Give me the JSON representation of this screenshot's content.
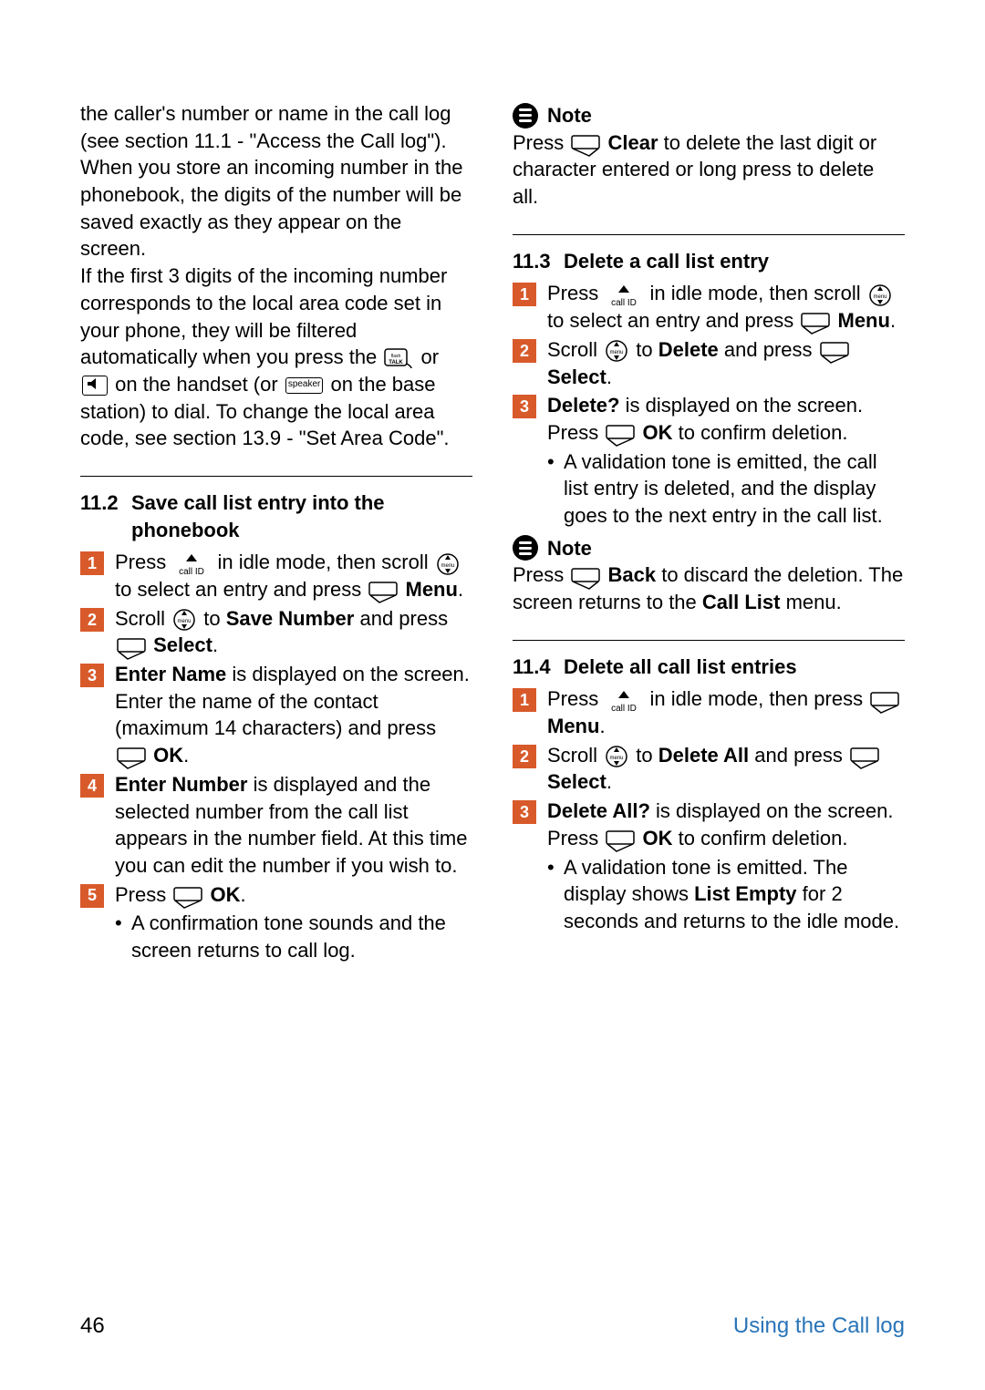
{
  "page_number": "46",
  "footer_title": "Using the Call log",
  "left": {
    "p1a": "the caller's number or name in the call log (see section 11.1 - \"Access the Call log\").",
    "p1b": "When you store an incoming number in the phonebook, the digits of the number will be saved exactly as they appear on the screen.",
    "p1c_a": "If the first 3 digits of the incoming number corresponds to the local area code set in your phone, they will be filtered automatically when you press the ",
    "p1c_b": " or ",
    "p1c_c": " on the handset (or ",
    "p1c_d": " on the base station) to dial. To change the local area code, see section 13.9 - \"Set Area Code\".",
    "sec112_num": "11.2",
    "sec112_title": "Save call list entry into the phonebook",
    "s112": {
      "n1": "1",
      "n2": "2",
      "n3": "3",
      "n4": "4",
      "n5": "5",
      "t1a": "Press ",
      "t1b": " in idle mode, then scroll ",
      "t1c": " to select an entry and press ",
      "t1d": "Menu",
      "t1e": ".",
      "t2a": "Scroll ",
      "t2b": " to ",
      "t2c": "Save Number",
      "t2d": " and press ",
      "t2e": "Select",
      "t2f": ".",
      "t3a": "Enter Name",
      "t3b": " is displayed on the screen. Enter the name of the contact (maximum 14 characters) and press ",
      "t3c": "OK",
      "t3d": ".",
      "t4a": "Enter Number",
      "t4b": " is displayed and the selected number from the call list appears in the number field. At this time you can edit the number if you wish to.",
      "t5a": "Press ",
      "t5b": "OK",
      "t5c": ".",
      "b1": "A confirmation tone sounds and the screen returns to call log."
    }
  },
  "right": {
    "note1_label": "Note",
    "note1a": "Press ",
    "note1b": "Clear",
    "note1c": " to delete the last digit or character entered or long press to delete all.",
    "sec113_num": "11.3",
    "sec113_title": "Delete a call list entry",
    "s113": {
      "n1": "1",
      "n2": "2",
      "n3": "3",
      "t1a": "Press ",
      "t1b": " in idle mode, then scroll ",
      "t1c": " to select an entry and press ",
      "t1d": "Menu",
      "t1e": ".",
      "t2a": "Scroll ",
      "t2b": " to ",
      "t2c": "Delete",
      "t2d": " and press ",
      "t2e": "Select",
      "t2f": ".",
      "t3a": "Delete?",
      "t3b": " is displayed on the screen. Press ",
      "t3c": "OK",
      "t3d": " to confirm deletion.",
      "b1": "A validation tone is emitted, the call list entry is deleted, and the display goes to the next entry in the call list."
    },
    "note2_label": "Note",
    "note2a": "Press ",
    "note2b": "Back",
    "note2c": " to discard the deletion. The screen returns to the ",
    "note2d": "Call List",
    "note2e": " menu.",
    "sec114_num": "11.4",
    "sec114_title": "Delete all call list entries",
    "s114": {
      "n1": "1",
      "n2": "2",
      "n3": "3",
      "t1a": "Press ",
      "t1b": " in idle mode, then press ",
      "t1c": "Menu",
      "t1d": ".",
      "t2a": "Scroll ",
      "t2b": " to ",
      "t2c": "Delete All",
      "t2d": " and press ",
      "t2e": "Select",
      "t2f": ".",
      "t3a": "Delete All?",
      "t3b": " is displayed on the screen. Press ",
      "t3c": "OK",
      "t3d": " to confirm deletion.",
      "b1a": "A validation tone is emitted. The display shows ",
      "b1b": "List Empty",
      "b1c": " for 2 seconds and returns to the idle mode."
    }
  },
  "icons": {
    "talk_label": "flash TALK",
    "speaker_label": "speaker"
  }
}
